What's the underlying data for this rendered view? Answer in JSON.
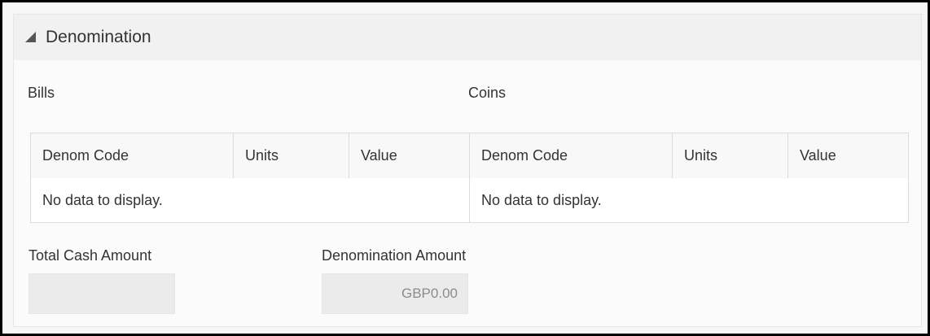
{
  "panel": {
    "title": "Denomination",
    "collapse_icon": "triangle-down-left-icon"
  },
  "bills": {
    "label": "Bills",
    "columns": [
      "Denom Code",
      "Units",
      "Value"
    ],
    "empty_message": "No data to display."
  },
  "coins": {
    "label": "Coins",
    "columns": [
      "Denom Code",
      "Units",
      "Value"
    ],
    "empty_message": "No data to display."
  },
  "fields": {
    "total_cash_amount": {
      "label": "Total Cash Amount",
      "value": ""
    },
    "denomination_amount": {
      "label": "Denomination Amount",
      "value": "GBP0.00"
    }
  },
  "colors": {
    "header_bg": "#f1f1f1",
    "table_border": "#dcdcdc",
    "readonly_field_bg": "#ebebeb",
    "readonly_text": "#8c8c8c"
  }
}
